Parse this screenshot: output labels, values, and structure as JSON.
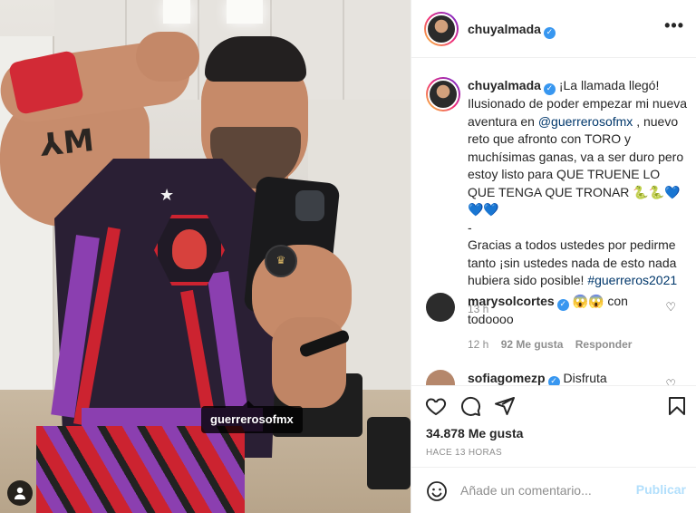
{
  "post": {
    "username": "chuyalmada",
    "more_label": "•••",
    "photo_tag": "guerrerosofmx"
  },
  "caption": {
    "username": "chuyalmada",
    "text_part1": "¡La llamada llegó! Ilusionado de poder empezar mi nueva aventura en ",
    "mention": "@guerrerosofmx",
    "text_part2": " , nuevo reto que afronto con TORO y muchísimas ganas, va a ser duro pero estoy listo para QUE TRUENE LO QUE TENGA QUE TRONAR 🐍🐍💙💙💙",
    "dash": "-",
    "text_part3": "Gracias a todos ustedes por pedirme tanto ¡sin ustedes nada de esto nada hubiera sido posible! ",
    "hashtag": "#guerreros2021",
    "time": "13 h"
  },
  "comments": [
    {
      "username": "marysolcortes",
      "text": "😱😱 con todoooo",
      "time": "12 h",
      "likes": "92 Me gusta",
      "reply": "Responder"
    },
    {
      "username": "sofiagomezp",
      "text": "Disfruta"
    }
  ],
  "stats": {
    "likes": "34.878 Me gusta",
    "posted": "HACE 13 HORAS"
  },
  "add_comment": {
    "placeholder": "Añade un comentario...",
    "post_label": "Publicar"
  },
  "icons": {
    "verified": "verified-badge-icon",
    "like": "heart-icon",
    "comment": "comment-icon",
    "share": "paper-plane-icon",
    "save": "bookmark-icon",
    "emoji": "smiley-icon",
    "user_tag": "person-icon"
  },
  "colors": {
    "verified": "#3897f0",
    "link": "#00376b",
    "post_button_disabled": "#b2dffc",
    "wristband": "#d22a36",
    "suit_purple": "#8b3fb0"
  }
}
